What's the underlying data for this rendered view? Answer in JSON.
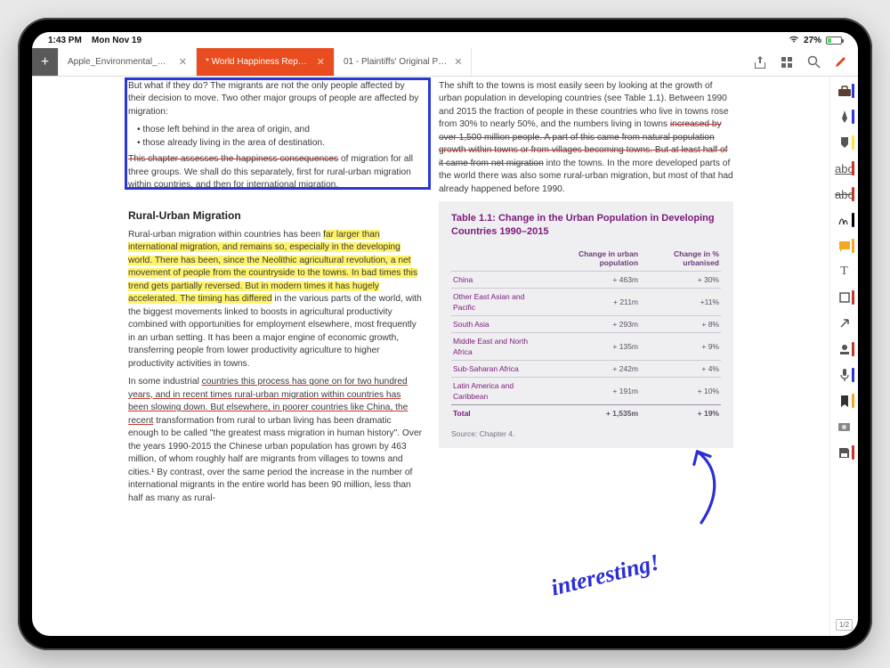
{
  "statusbar": {
    "time": "1:43 PM",
    "date": "Mon Nov 19",
    "battery_pct": "27%"
  },
  "tabs": [
    {
      "label": "Apple_Environmental_R…",
      "active": false
    },
    {
      "label": "* World Happiness Repo…",
      "active": true
    },
    {
      "label": "01 - Plaintiffs' Original P…",
      "active": false
    }
  ],
  "doc": {
    "left": {
      "p1": "But what if they do? The migrants are not the only people affected by their decision to move. Two other major groups of people are affected by migration:",
      "b1": "those left behind in the area of origin, and",
      "b2": "those already living in the area of destination.",
      "p2_strike": "This chapter assesses the happiness consequences",
      "p2_rest": "of migration for all three groups. We shall do this separately, first for rural-urban migration within countries, and then for international migration.",
      "h2": "Rural-Urban Migration",
      "p3_pre": "Rural-urban migration within countries has been ",
      "p3_hl": "far larger than international migration, and remains so, especially in the developing world. There has been, since the Neolithic agricultural revolution, a net movement of people from the countryside to the towns. In bad times this trend gets partially reversed. But in modern times it has hugely accelerated. The timing has differed",
      "p3_post": " in the various parts of the world, with the biggest movements linked to boosts in agricultural productivity combined with opportunities for employment elsewhere, most frequently in an urban setting. It has been a major engine of economic growth, transferring people from lower productivity agriculture to higher productivity activities in towns.",
      "p4_pre": "In some industrial ",
      "p4_und": "countries this process has gone on for two hundred years, and in recent times rural-urban migration within countries has been slowing down. But elsewhere, in poorer countries like China, the recent",
      "p4_post": " transformation from rural to urban living has been dramatic enough to be called \"the greatest mass migration in human history\". Over the years 1990-2015 the Chinese urban population has grown by 463 million, of whom roughly half are migrants from villages to towns and cities.¹ By contrast, over the same period the increase in the number of international migrants in the entire world has been 90 million, less than half as many as rural-"
    },
    "right": {
      "p1_pre": "The shift to the towns is most easily seen by looking at the growth of urban population in developing countries (see Table 1.1). Between 1990 and 2015 the fraction of people in these countries who live in towns rose from 30% to nearly 50%, and the numbers living in towns ",
      "p1_strike": "increased by over 1,500 million people. A part of this came from natural population growth within towns or from villages becoming towns. But at least half of it came from net migration",
      "p1_post": " into the towns. In the more developed parts of the world there was also some rural-urban migration, but most of that had already happened before 1990."
    }
  },
  "table": {
    "title": "Table 1.1: Change in the Urban Population in Developing Countries 1990–2015",
    "head": [
      "",
      "Change in urban population",
      "Change in % urbanised"
    ],
    "rows": [
      [
        "China",
        "+ 463m",
        "+ 30%"
      ],
      [
        "Other East Asian and Pacific",
        "+ 211m",
        "+11%"
      ],
      [
        "South Asia",
        "+ 293m",
        "+ 8%"
      ],
      [
        "Middle East and North Africa",
        "+ 135m",
        "+ 9%"
      ],
      [
        "Sub-Saharan Africa",
        "+ 242m",
        "+ 4%"
      ],
      [
        "Latin America and Caribbean",
        "+ 191m",
        "+ 10%"
      ]
    ],
    "total": [
      "Total",
      "+ 1,535m",
      "+ 19%"
    ],
    "source": "Source: Chapter 4."
  },
  "annotation": {
    "text": "interesting!"
  },
  "rail": {
    "page_indicator": "1/2",
    "tools": [
      {
        "name": "toolbox-icon",
        "color": "#2b36d6"
      },
      {
        "name": "pen-icon",
        "color": "#2b36d6"
      },
      {
        "name": "highlighter-icon",
        "color": "#ffe24a"
      },
      {
        "name": "underline-icon",
        "color": "#c6372b"
      },
      {
        "name": "strikethrough-icon",
        "color": "#c6372b"
      },
      {
        "name": "signature-icon",
        "color": "#000"
      },
      {
        "name": "note-icon",
        "color": "#f5a623"
      },
      {
        "name": "text-icon",
        "color": null
      },
      {
        "name": "rect-icon",
        "color": "#c6372b"
      },
      {
        "name": "arrow-icon",
        "color": null
      },
      {
        "name": "stamp-icon",
        "color": "#c6372b"
      },
      {
        "name": "mic-icon",
        "color": "#2b36d6"
      },
      {
        "name": "bookmark-icon",
        "color": "#f5a623"
      },
      {
        "name": "camera-icon",
        "color": null
      },
      {
        "name": "save-icon",
        "color": "#c6372b"
      }
    ]
  }
}
